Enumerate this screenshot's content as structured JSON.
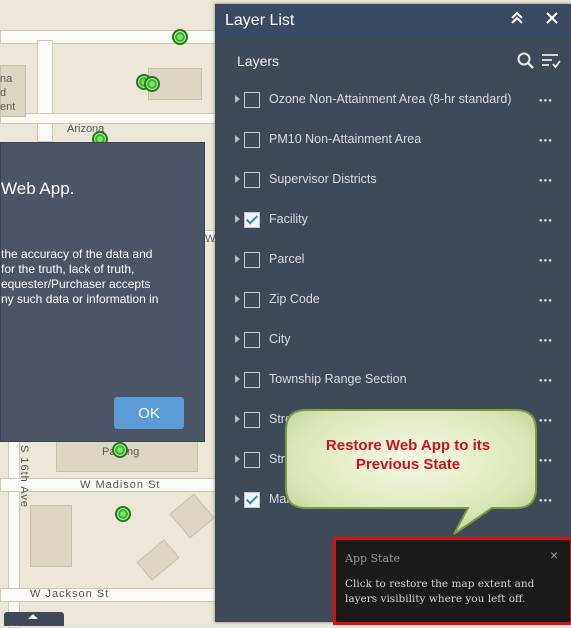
{
  "map": {
    "labels": {
      "arizona": "Arizona",
      "frag_na": "na",
      "frag_ent": "ent",
      "frag_d": "d",
      "frag_w": "W",
      "parking": "Parking",
      "madison": "W Madison St",
      "jackson": "W Jackson St",
      "ave16": "S 16th Ave"
    }
  },
  "splash": {
    "title": "Web App.",
    "body": [
      "the accuracy of the data and",
      " for the truth, lack of truth,",
      "equester/Purchaser accepts",
      "ny such data or information in"
    ],
    "ok_label": "OK"
  },
  "panel": {
    "title": "Layer List",
    "layers_label": "Layers",
    "layers": [
      {
        "name": "Ozone Non-Attainment Area (8-hr standard)",
        "checked": false
      },
      {
        "name": "PM10 Non-Attainment Area",
        "checked": false
      },
      {
        "name": "Supervisor Districts",
        "checked": false
      },
      {
        "name": "Facility",
        "checked": true
      },
      {
        "name": "Parcel",
        "checked": false
      },
      {
        "name": "Zip Code",
        "checked": false
      },
      {
        "name": "City",
        "checked": false
      },
      {
        "name": "Township Range Section",
        "checked": false
      },
      {
        "name": "Stre",
        "checked": false
      },
      {
        "name": "Stre",
        "checked": false
      },
      {
        "name": "Maric",
        "checked": true
      }
    ]
  },
  "callout": {
    "text_line1": "Restore Web App to its",
    "text_line2": "Previous State"
  },
  "app_state": {
    "title": "App State",
    "close": "×",
    "message": "Click to restore the map extent and layers visibility where you left off."
  },
  "colors": {
    "panel_bg": "#3f4a59",
    "header_bg": "#3a4a63",
    "accent_red": "#d0141a",
    "ok_blue": "#5b9bd8",
    "pin_green": "#39b02e"
  }
}
